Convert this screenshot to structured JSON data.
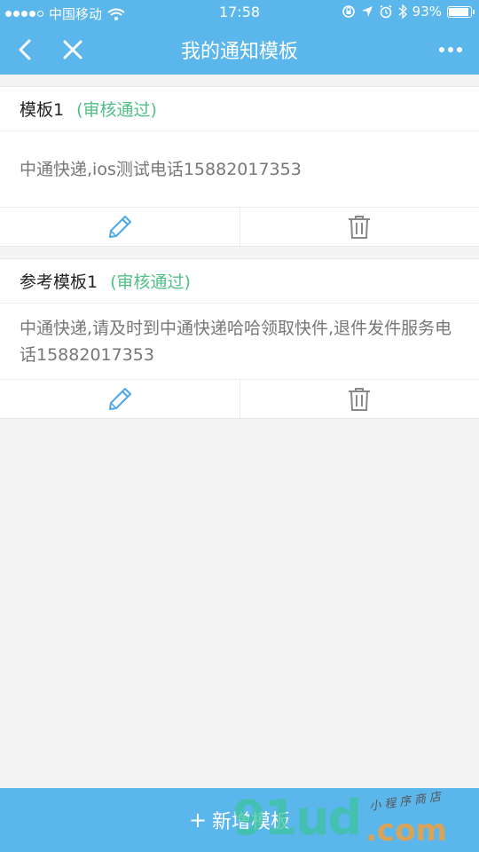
{
  "status_bar": {
    "carrier": "中国移动",
    "time": "17:58",
    "battery": "93%",
    "battery_level": 0.93
  },
  "nav": {
    "title": "我的通知模板",
    "back_icon": "chevron-left-icon",
    "close_icon": "close-icon",
    "more_icon": "more-dots-icon"
  },
  "templates": [
    {
      "name": "模板1",
      "status": "(审核通过)",
      "content": "中通快递,ios测试电话15882017353",
      "edit_icon": "pencil-icon",
      "delete_icon": "trash-icon"
    },
    {
      "name": "参考模板1",
      "status": "(审核通过)",
      "content": "中通快递,请及时到中通快递哈哈领取快件,退件发件服务电话15882017353",
      "edit_icon": "pencil-icon",
      "delete_icon": "trash-icon"
    }
  ],
  "footer": {
    "plus": "+",
    "add_label": "新增模板"
  },
  "watermark": {
    "big": "91ud",
    "com": ".com",
    "small": "小程序商店"
  },
  "colors": {
    "brand": "#5bb6ec",
    "status_ok": "#4fbf86",
    "icon_edit": "#4aa8e6",
    "icon_delete": "#888888"
  }
}
